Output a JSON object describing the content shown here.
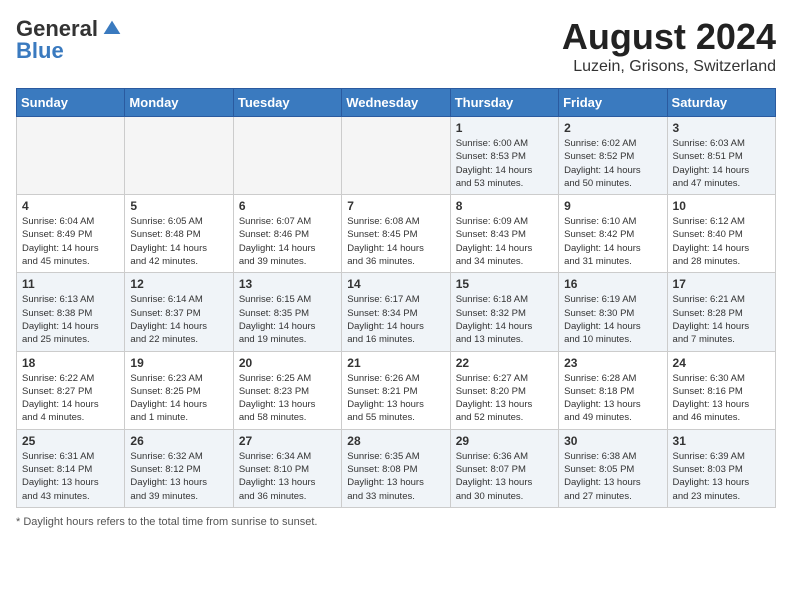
{
  "header": {
    "logo_general": "General",
    "logo_blue": "Blue",
    "month_year": "August 2024",
    "location": "Luzein, Grisons, Switzerland"
  },
  "weekdays": [
    "Sunday",
    "Monday",
    "Tuesday",
    "Wednesday",
    "Thursday",
    "Friday",
    "Saturday"
  ],
  "footer": {
    "note": "Daylight hours"
  },
  "weeks": [
    [
      {
        "day": "",
        "info": ""
      },
      {
        "day": "",
        "info": ""
      },
      {
        "day": "",
        "info": ""
      },
      {
        "day": "",
        "info": ""
      },
      {
        "day": "1",
        "info": "Sunrise: 6:00 AM\nSunset: 8:53 PM\nDaylight: 14 hours\nand 53 minutes."
      },
      {
        "day": "2",
        "info": "Sunrise: 6:02 AM\nSunset: 8:52 PM\nDaylight: 14 hours\nand 50 minutes."
      },
      {
        "day": "3",
        "info": "Sunrise: 6:03 AM\nSunset: 8:51 PM\nDaylight: 14 hours\nand 47 minutes."
      }
    ],
    [
      {
        "day": "4",
        "info": "Sunrise: 6:04 AM\nSunset: 8:49 PM\nDaylight: 14 hours\nand 45 minutes."
      },
      {
        "day": "5",
        "info": "Sunrise: 6:05 AM\nSunset: 8:48 PM\nDaylight: 14 hours\nand 42 minutes."
      },
      {
        "day": "6",
        "info": "Sunrise: 6:07 AM\nSunset: 8:46 PM\nDaylight: 14 hours\nand 39 minutes."
      },
      {
        "day": "7",
        "info": "Sunrise: 6:08 AM\nSunset: 8:45 PM\nDaylight: 14 hours\nand 36 minutes."
      },
      {
        "day": "8",
        "info": "Sunrise: 6:09 AM\nSunset: 8:43 PM\nDaylight: 14 hours\nand 34 minutes."
      },
      {
        "day": "9",
        "info": "Sunrise: 6:10 AM\nSunset: 8:42 PM\nDaylight: 14 hours\nand 31 minutes."
      },
      {
        "day": "10",
        "info": "Sunrise: 6:12 AM\nSunset: 8:40 PM\nDaylight: 14 hours\nand 28 minutes."
      }
    ],
    [
      {
        "day": "11",
        "info": "Sunrise: 6:13 AM\nSunset: 8:38 PM\nDaylight: 14 hours\nand 25 minutes."
      },
      {
        "day": "12",
        "info": "Sunrise: 6:14 AM\nSunset: 8:37 PM\nDaylight: 14 hours\nand 22 minutes."
      },
      {
        "day": "13",
        "info": "Sunrise: 6:15 AM\nSunset: 8:35 PM\nDaylight: 14 hours\nand 19 minutes."
      },
      {
        "day": "14",
        "info": "Sunrise: 6:17 AM\nSunset: 8:34 PM\nDaylight: 14 hours\nand 16 minutes."
      },
      {
        "day": "15",
        "info": "Sunrise: 6:18 AM\nSunset: 8:32 PM\nDaylight: 14 hours\nand 13 minutes."
      },
      {
        "day": "16",
        "info": "Sunrise: 6:19 AM\nSunset: 8:30 PM\nDaylight: 14 hours\nand 10 minutes."
      },
      {
        "day": "17",
        "info": "Sunrise: 6:21 AM\nSunset: 8:28 PM\nDaylight: 14 hours\nand 7 minutes."
      }
    ],
    [
      {
        "day": "18",
        "info": "Sunrise: 6:22 AM\nSunset: 8:27 PM\nDaylight: 14 hours\nand 4 minutes."
      },
      {
        "day": "19",
        "info": "Sunrise: 6:23 AM\nSunset: 8:25 PM\nDaylight: 14 hours\nand 1 minute."
      },
      {
        "day": "20",
        "info": "Sunrise: 6:25 AM\nSunset: 8:23 PM\nDaylight: 13 hours\nand 58 minutes."
      },
      {
        "day": "21",
        "info": "Sunrise: 6:26 AM\nSunset: 8:21 PM\nDaylight: 13 hours\nand 55 minutes."
      },
      {
        "day": "22",
        "info": "Sunrise: 6:27 AM\nSunset: 8:20 PM\nDaylight: 13 hours\nand 52 minutes."
      },
      {
        "day": "23",
        "info": "Sunrise: 6:28 AM\nSunset: 8:18 PM\nDaylight: 13 hours\nand 49 minutes."
      },
      {
        "day": "24",
        "info": "Sunrise: 6:30 AM\nSunset: 8:16 PM\nDaylight: 13 hours\nand 46 minutes."
      }
    ],
    [
      {
        "day": "25",
        "info": "Sunrise: 6:31 AM\nSunset: 8:14 PM\nDaylight: 13 hours\nand 43 minutes."
      },
      {
        "day": "26",
        "info": "Sunrise: 6:32 AM\nSunset: 8:12 PM\nDaylight: 13 hours\nand 39 minutes."
      },
      {
        "day": "27",
        "info": "Sunrise: 6:34 AM\nSunset: 8:10 PM\nDaylight: 13 hours\nand 36 minutes."
      },
      {
        "day": "28",
        "info": "Sunrise: 6:35 AM\nSunset: 8:08 PM\nDaylight: 13 hours\nand 33 minutes."
      },
      {
        "day": "29",
        "info": "Sunrise: 6:36 AM\nSunset: 8:07 PM\nDaylight: 13 hours\nand 30 minutes."
      },
      {
        "day": "30",
        "info": "Sunrise: 6:38 AM\nSunset: 8:05 PM\nDaylight: 13 hours\nand 27 minutes."
      },
      {
        "day": "31",
        "info": "Sunrise: 6:39 AM\nSunset: 8:03 PM\nDaylight: 13 hours\nand 23 minutes."
      }
    ]
  ]
}
